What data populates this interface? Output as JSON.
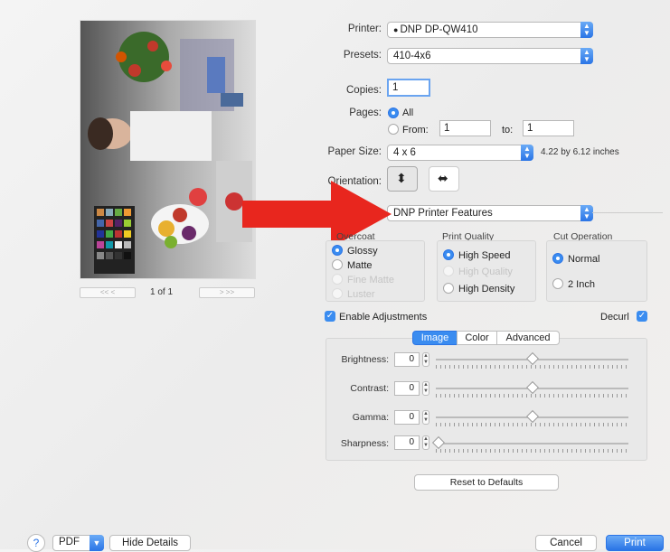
{
  "preview": {
    "page_label": "1 of 1",
    "nav_prev": "<<  <",
    "nav_next": ">  >>"
  },
  "printer": {
    "label": "Printer:",
    "value": "DNP DP-QW410"
  },
  "presets": {
    "label": "Presets:",
    "value": "410-4x6"
  },
  "copies": {
    "label": "Copies:",
    "value": "1"
  },
  "pages": {
    "label": "Pages:",
    "all_label": "All",
    "from_label": "From:",
    "from_value": "1",
    "to_label": "to:",
    "to_value": "1"
  },
  "paper_size": {
    "label": "Paper Size:",
    "value": "4 x 6",
    "dimensions": "4.22 by 6.12 inches"
  },
  "orientation": {
    "label": "Orientation:"
  },
  "section_popup": {
    "value": "DNP Printer Features"
  },
  "overcoat": {
    "title": "Overcoat",
    "options": [
      "Glossy",
      "Matte",
      "Fine Matte",
      "Luster"
    ]
  },
  "print_quality": {
    "title": "Print Quality",
    "options": [
      "High Speed",
      "High Quality",
      "High Density"
    ]
  },
  "cut_operation": {
    "title": "Cut Operation",
    "options": [
      "Normal",
      "2 Inch"
    ]
  },
  "enable_adjustments": {
    "label": "Enable Adjustments"
  },
  "decurl": {
    "label": "Decurl"
  },
  "tabs": [
    "Image",
    "Color",
    "Advanced"
  ],
  "adjustments": {
    "brightness_label": "Brightness:",
    "brightness_value": "0",
    "contrast_label": "Contrast:",
    "contrast_value": "0",
    "gamma_label": "Gamma:",
    "gamma_value": "0",
    "sharpness_label": "Sharpness:",
    "sharpness_value": "0"
  },
  "reset_button": "Reset to Defaults",
  "footer": {
    "help": "?",
    "pdf": "PDF",
    "hide_details": "Hide Details",
    "cancel": "Cancel",
    "print": "Print"
  },
  "colors": {
    "accent": "#3a8cf0",
    "arrow": "#e8261e"
  }
}
